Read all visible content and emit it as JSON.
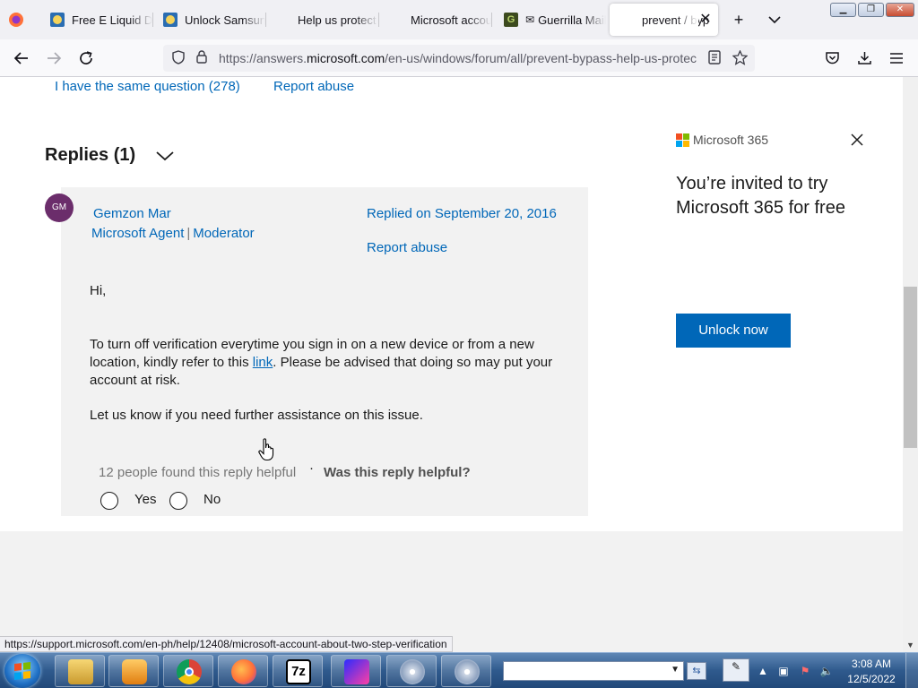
{
  "browser": {
    "tabs": [
      {
        "title": "Free E Liquid Do",
        "favicon": "wiki-icon"
      },
      {
        "title": "Unlock Samsung",
        "favicon": "wiki-icon"
      },
      {
        "title": "Help us protect",
        "favicon": "microsoft-icon"
      },
      {
        "title": "Microsoft accou",
        "favicon": "microsoft-icon"
      },
      {
        "title": "Guerrilla Mail",
        "favicon": "guerrilla-icon"
      },
      {
        "title": "prevent / byp",
        "favicon": "microsoft-icon",
        "active": true
      }
    ],
    "new_tab": "+",
    "tab_list": "⌄",
    "url_prefix": "https://answers.",
    "url_domain": "microsoft.com",
    "url_suffix": "/en-us/windows/forum/all/prevent-bypass-help-us-protec",
    "status_url": "https://support.microsoft.com/en-ph/help/12408/microsoft-account-about-two-step-verification"
  },
  "question_actions": {
    "same_question": "I have the same question (278)",
    "report_abuse": "Report abuse"
  },
  "replies": {
    "heading": "Replies (1)",
    "reply": {
      "avatar_initials": "GM",
      "author": "Gemzon Mar",
      "role_1": "Microsoft Agent",
      "role_sep": "|",
      "role_2": "Moderator",
      "replied_on": "Replied on September 20, 2016",
      "report_abuse": "Report abuse",
      "greeting": "Hi,",
      "para1_before": "To turn off verification everytime you sign in on a new device or from a new location, kindly refer to this ",
      "para1_link": "link",
      "para1_after": ". Please be advised that doing so may put your account at risk.",
      "para2": "Let us know if you need further assistance on this issue.",
      "helpful_count": "12 people found this reply helpful",
      "separator": "·",
      "helpful_question": "Was this reply helpful?",
      "yes": "Yes",
      "no": "No"
    }
  },
  "promo": {
    "brand": "Microsoft 365",
    "headline": "You’re invited to try Microsoft 365 for free",
    "cta": "Unlock now"
  },
  "taskbar": {
    "time": "3:08 AM",
    "date": "12/5/2022",
    "seven_zip_label": "7z"
  },
  "colors": {
    "link": "#0067b8",
    "cta_bg": "#0067b8",
    "avatar_bg": "#6b2d6b"
  }
}
